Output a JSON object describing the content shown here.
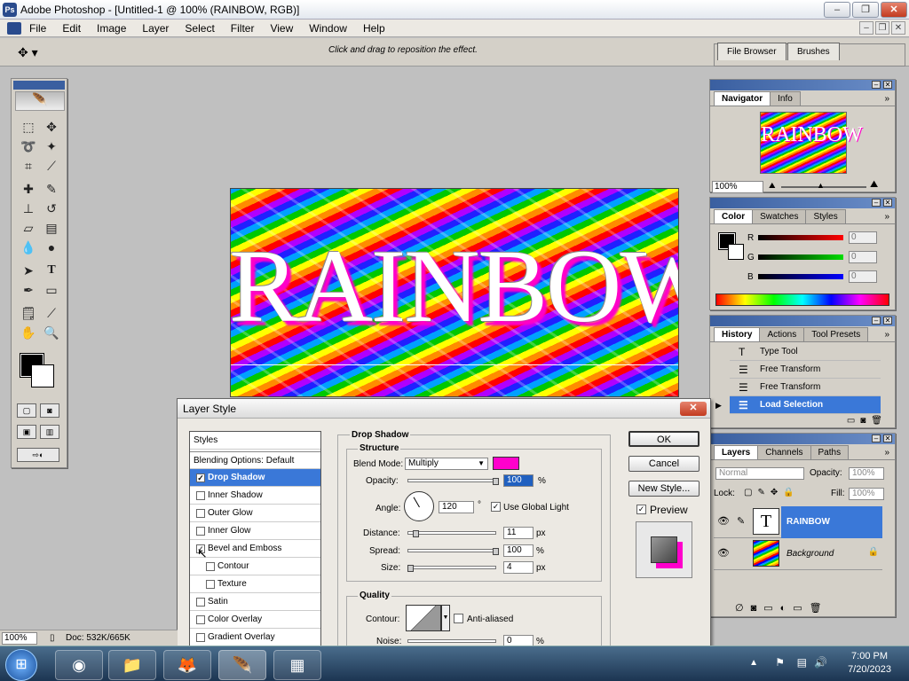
{
  "window": {
    "title": "Adobe Photoshop - [Untitled-1 @ 100% (RAINBOW, RGB)]",
    "controls": [
      "–",
      "❐",
      "✕"
    ]
  },
  "menu": [
    "File",
    "Edit",
    "Image",
    "Layer",
    "Select",
    "Filter",
    "View",
    "Window",
    "Help"
  ],
  "options": {
    "hint": "Click and drag to reposition the effect.",
    "well_tabs": [
      "File Browser",
      "Brushes"
    ]
  },
  "canvas": {
    "text": "RAINBOW"
  },
  "navigator": {
    "tabs": [
      "Navigator",
      "Info"
    ],
    "thumb_text": "RAINBOW",
    "zoom": "100%"
  },
  "color": {
    "tabs": [
      "Color",
      "Swatches",
      "Styles"
    ],
    "r": "0",
    "g": "0",
    "b": "0",
    "r_label": "R",
    "g_label": "G",
    "b_label": "B"
  },
  "history": {
    "tabs": [
      "History",
      "Actions",
      "Tool Presets"
    ],
    "items": [
      "Type Tool",
      "Free Transform",
      "Free Transform",
      "Load Selection"
    ]
  },
  "layers": {
    "tabs": [
      "Layers",
      "Channels",
      "Paths"
    ],
    "mode": "Normal",
    "opacity_label": "Opacity:",
    "opacity": "100%",
    "lock_label": "Lock:",
    "fill_label": "Fill:",
    "fill": "100%",
    "items": [
      "RAINBOW",
      "Background"
    ]
  },
  "dialog": {
    "title": "Layer Style",
    "styles_header": "Styles",
    "blending": "Blending Options: Default",
    "styles": [
      {
        "label": "Drop Shadow",
        "checked": "✓"
      },
      {
        "label": "Inner Shadow",
        "checked": ""
      },
      {
        "label": "Outer Glow",
        "checked": ""
      },
      {
        "label": "Inner Glow",
        "checked": ""
      },
      {
        "label": "Bevel and Emboss",
        "checked": "✓"
      },
      {
        "label": "Contour",
        "checked": ""
      },
      {
        "label": "Texture",
        "checked": ""
      },
      {
        "label": "Satin",
        "checked": ""
      },
      {
        "label": "Color Overlay",
        "checked": ""
      },
      {
        "label": "Gradient Overlay",
        "checked": ""
      }
    ],
    "section": "Drop Shadow",
    "structure": "Structure",
    "blend_mode_label": "Blend Mode:",
    "blend_mode": "Multiply",
    "shadow_color": "#ff00cc",
    "opacity_label": "Opacity:",
    "opacity": "100",
    "angle_label": "Angle:",
    "angle": "120",
    "use_global_light": "Use Global Light",
    "distance_label": "Distance:",
    "distance": "11",
    "spread_label": "Spread:",
    "spread": "100",
    "size_label": "Size:",
    "size": "4",
    "pct": "%",
    "px": "px",
    "deg": "°",
    "quality": "Quality",
    "contour_label": "Contour:",
    "antialiased": "Anti-aliased",
    "noise_label": "Noise:",
    "noise": "0",
    "ok": "OK",
    "cancel": "Cancel",
    "new_style": "New Style...",
    "preview": "Preview"
  },
  "status": {
    "zoom": "100%",
    "doc": "Doc: 532K/665K"
  },
  "taskbar": {
    "time": "7:00 PM",
    "date": "7/20/2023"
  }
}
